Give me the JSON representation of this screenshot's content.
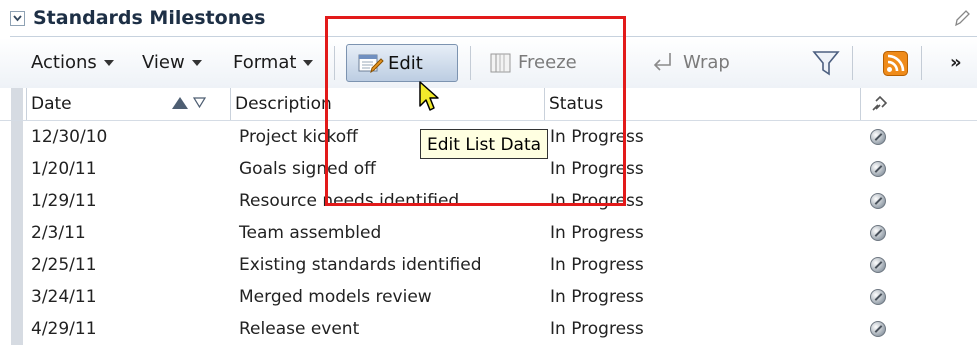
{
  "title": "Standards Milestones",
  "toolbar": {
    "actions": "Actions",
    "view": "View",
    "format": "Format",
    "edit": "Edit",
    "freeze": "Freeze",
    "wrap": "Wrap",
    "more": "»"
  },
  "columns": {
    "date": "Date",
    "description": "Description",
    "status": "Status"
  },
  "tooltip": "Edit List Data",
  "rows": [
    {
      "date": "12/30/10",
      "description": "Project kickoff",
      "status": "In Progress"
    },
    {
      "date": "1/20/11",
      "description": "Goals signed off",
      "status": "In Progress"
    },
    {
      "date": "1/29/11",
      "description": "Resource needs identified",
      "status": "In Progress"
    },
    {
      "date": "2/3/11",
      "description": "Team assembled",
      "status": "In Progress"
    },
    {
      "date": "2/25/11",
      "description": "Existing standards identified",
      "status": "In Progress"
    },
    {
      "date": "3/24/11",
      "description": "Merged models review",
      "status": "In Progress"
    },
    {
      "date": "4/29/11",
      "description": "Release event",
      "status": "In Progress"
    }
  ],
  "colors": {
    "highlight": "#e21a1a",
    "accent": "#e89522"
  },
  "icons": [
    "chevron-down-icon",
    "pencil-icon",
    "edit-icon",
    "freeze-icon",
    "wrap-icon",
    "filter-icon",
    "rss-icon",
    "link-icon",
    "sort-ascending-icon",
    "sort-descending-icon",
    "cursor-icon"
  ]
}
